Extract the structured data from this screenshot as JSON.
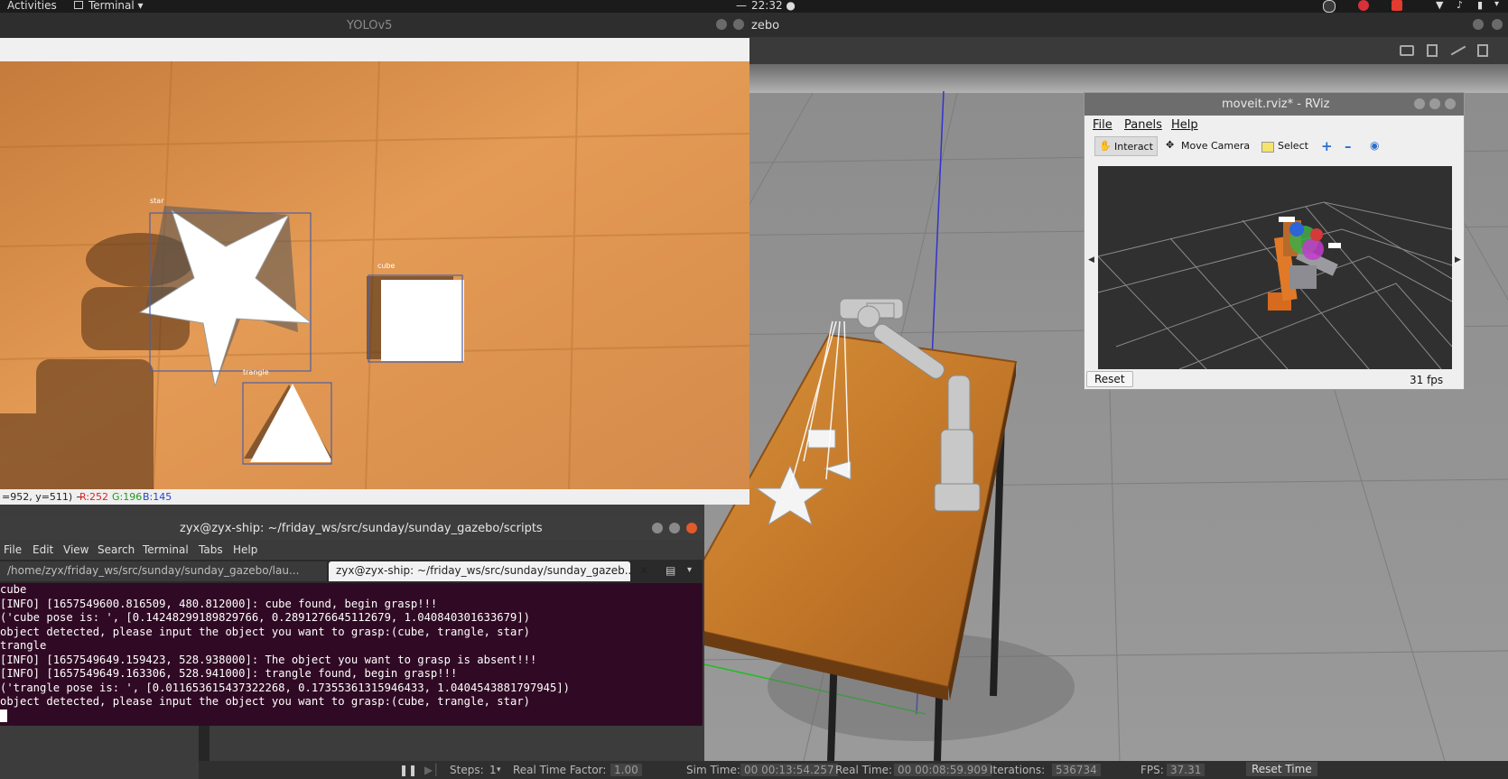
{
  "topbar": {
    "activities": "Activities",
    "app_menu": "Terminal ▾",
    "clock": "22:32 ●",
    "clock_dash": "—"
  },
  "gazebo": {
    "title": "zebo",
    "bottom": {
      "pause": "❚❚",
      "steps_label": "Steps:",
      "steps_value": "1",
      "rtf_label": "Real Time Factor:",
      "rtf_value": "1.00",
      "sim_time_label": "Sim Time:",
      "sim_time_value": "00 00:13:54.257",
      "real_time_label": "Real Time:",
      "real_time_value": "00 00:08:59.909",
      "iterations_label": "Iterations:",
      "iterations_value": "536734",
      "fps_label": "FPS:",
      "fps_value": "37.31",
      "reset_time": "Reset Time"
    }
  },
  "yolo": {
    "title": "YOLOv5",
    "labels": {
      "star": "star",
      "cube": "cube",
      "trangle": "trangle"
    },
    "status_prefix": "=952, y=511) ~",
    "status_r": "R:252",
    "status_g": "G:196",
    "status_b": "B:145"
  },
  "terminal": {
    "title": "zyx@zyx-ship: ~/friday_ws/src/sunday/sunday_gazebo/scripts",
    "menu": [
      "File",
      "Edit",
      "View",
      "Search",
      "Terminal",
      "Tabs",
      "Help"
    ],
    "tabs": [
      "/home/zyx/friday_ws/src/sunday/sunday_gazebo/lau...",
      "zyx@zyx-ship: ~/friday_ws/src/sunday/sunday_gazeb..."
    ],
    "lines": [
      "cube",
      "[INFO] [1657549600.816509, 480.812000]: cube found, begin grasp!!!",
      "('cube pose is: ', [0.14248299189829766, 0.2891276645112679, 1.040840301633679])",
      "object detected, please input the object you want to grasp:(cube, trangle, star)",
      "trangle",
      "[INFO] [1657549649.159423, 528.938000]: The object you want to grasp is absent!!!",
      "[INFO] [1657549649.163306, 528.941000]: trangle found, begin grasp!!!",
      "('trangle pose is: ', [0.011653615437322268, 0.17355361315946433, 1.0404543881797945])",
      "object detected, please input the object you want to grasp:(cube, trangle, star)"
    ]
  },
  "rviz": {
    "title": "moveit.rviz* - RViz",
    "menu": [
      "File",
      "Panels",
      "Help"
    ],
    "tools": {
      "interact": "Interact",
      "move_camera": "Move Camera",
      "select": "Select"
    },
    "reset": "Reset",
    "fps": "31 fps"
  }
}
